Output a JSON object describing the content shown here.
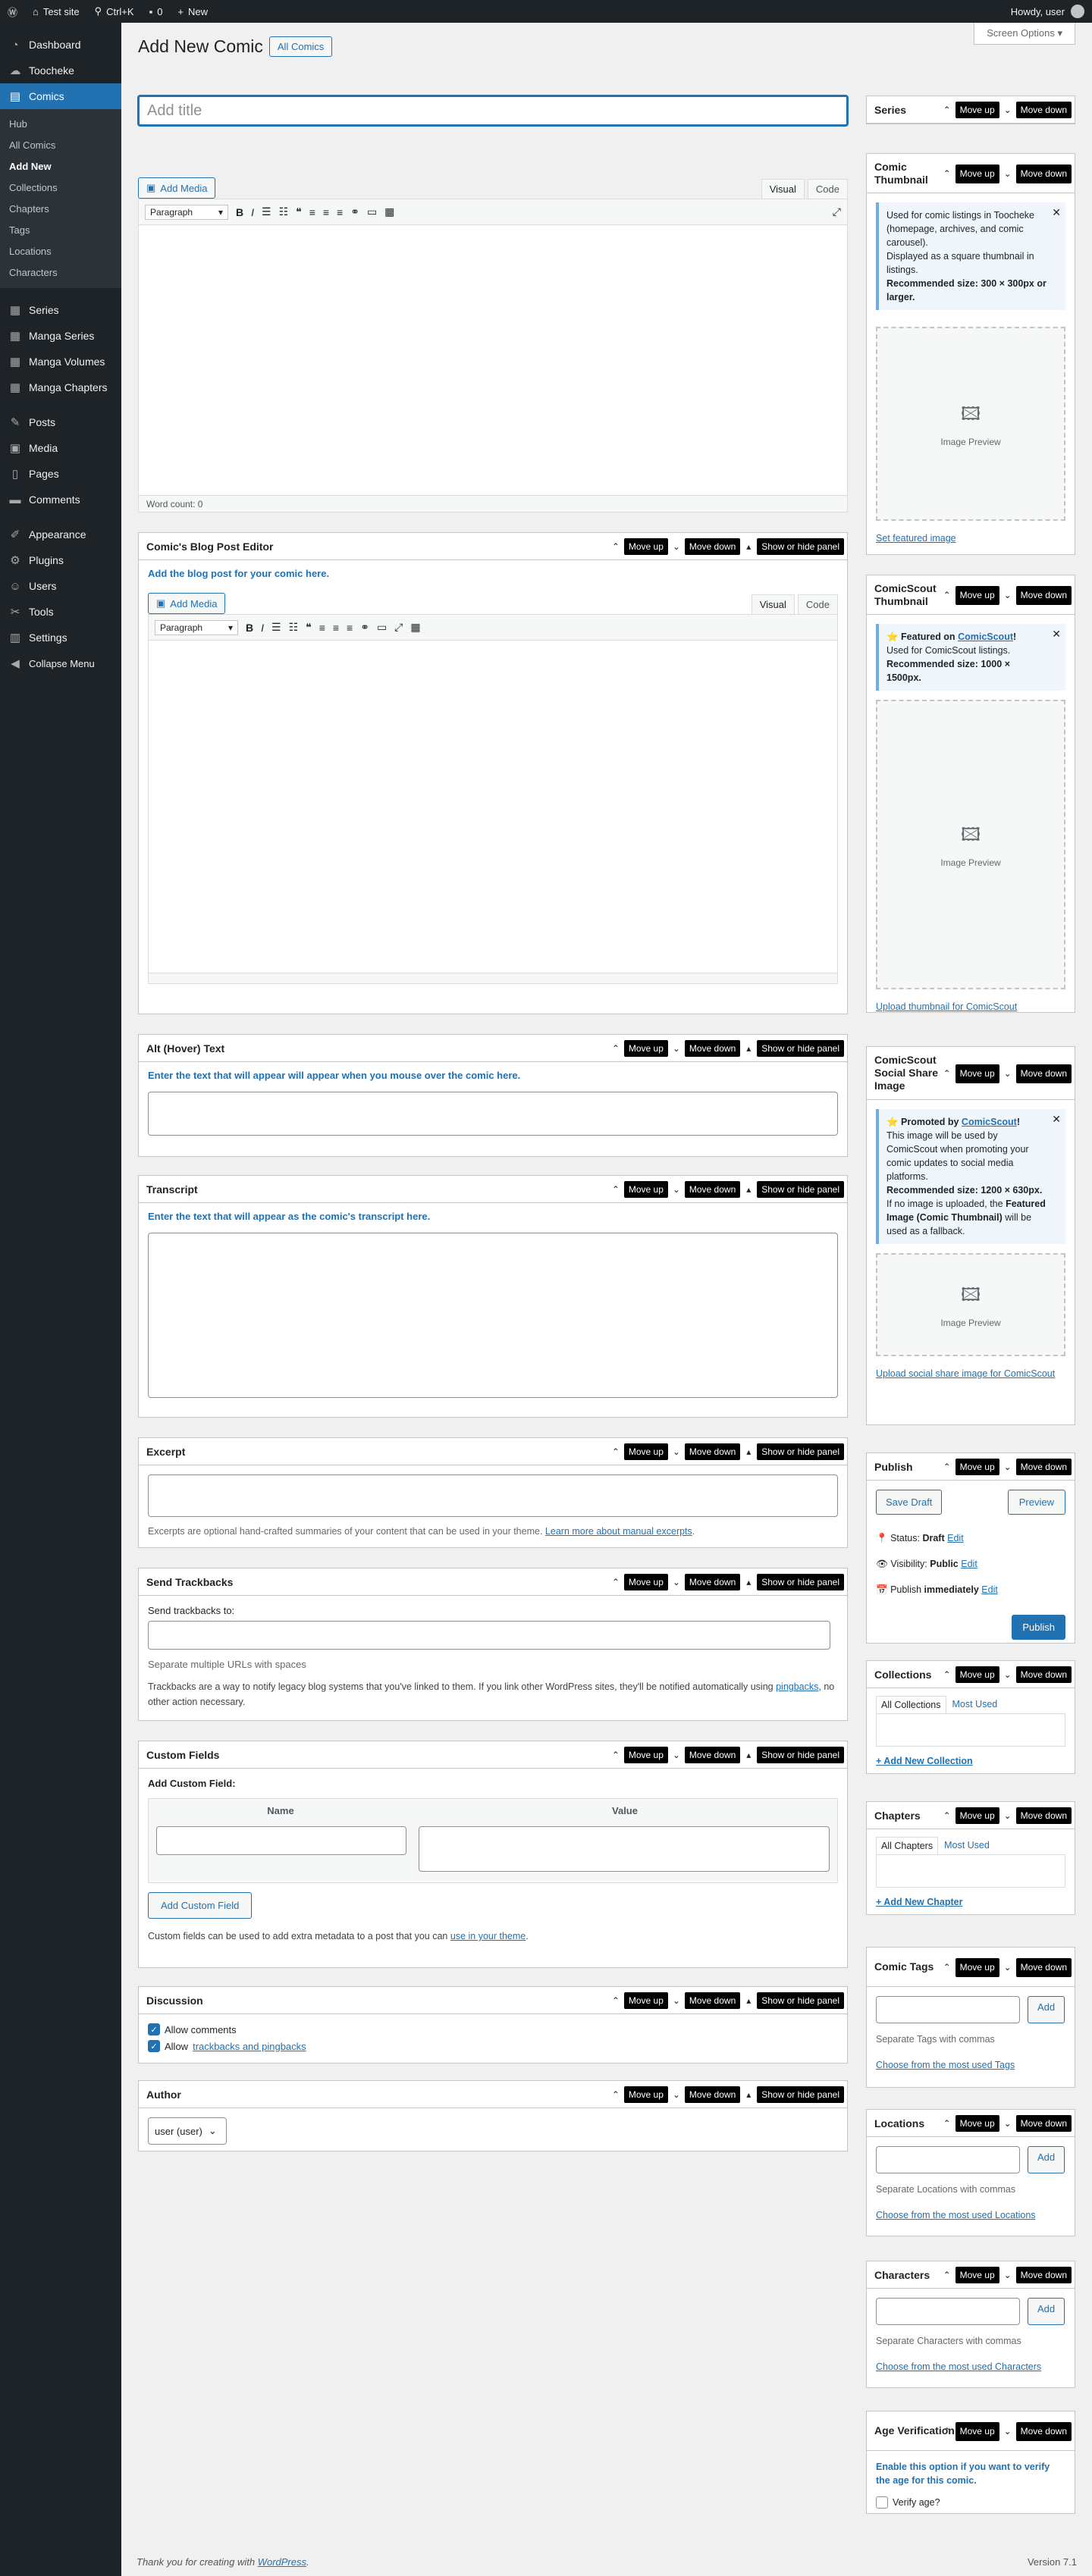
{
  "adminbar": {
    "site": "Test site",
    "search": "Ctrl+K",
    "comments": "0",
    "new": "New",
    "howdy": "Howdy, user"
  },
  "sidebar": {
    "items": [
      {
        "label": "Dashboard",
        "icon": "dashboard-icon"
      },
      {
        "label": "Toocheke",
        "icon": "toocheke-icon"
      },
      {
        "label": "Comics",
        "icon": "comics-icon"
      }
    ],
    "submenu": [
      "Hub",
      "All Comics",
      "Add New",
      "Collections",
      "Chapters",
      "Tags",
      "Locations",
      "Characters"
    ],
    "items2": [
      {
        "label": "Series",
        "icon": "series-icon"
      },
      {
        "label": "Manga Series",
        "icon": "manga-series-icon"
      },
      {
        "label": "Manga Volumes",
        "icon": "manga-volumes-icon"
      },
      {
        "label": "Manga Chapters",
        "icon": "manga-chapters-icon"
      }
    ],
    "items3": [
      {
        "label": "Posts",
        "icon": "pin-icon"
      },
      {
        "label": "Media",
        "icon": "media-icon"
      },
      {
        "label": "Pages",
        "icon": "pages-icon"
      },
      {
        "label": "Comments",
        "icon": "comments-icon"
      }
    ],
    "items4": [
      {
        "label": "Appearance",
        "icon": "appearance-icon"
      },
      {
        "label": "Plugins",
        "icon": "plugins-icon"
      },
      {
        "label": "Users",
        "icon": "users-icon"
      },
      {
        "label": "Tools",
        "icon": "tools-icon"
      },
      {
        "label": "Settings",
        "icon": "settings-icon"
      },
      {
        "label": "Collapse Menu",
        "icon": "collapse-icon"
      }
    ]
  },
  "page": {
    "title": "Add New Comic",
    "all_comics": "All Comics",
    "screen_options": "Screen Options",
    "title_placeholder": "Add title"
  },
  "editor": {
    "add_media": "Add Media",
    "visual": "Visual",
    "code": "Code",
    "paragraph": "Paragraph",
    "word_count": "Word count: 0"
  },
  "controls": {
    "move_up": "Move up",
    "move_down": "Move down",
    "toggle": "Show or hide panel"
  },
  "blog": {
    "title": "Comic's Blog Post Editor",
    "intro": "Add the blog post for your comic here."
  },
  "alt": {
    "title": "Alt (Hover) Text",
    "intro": "Enter the text that will appear will appear when you mouse over the comic here."
  },
  "transcript": {
    "title": "Transcript",
    "intro": "Enter the text that will appear as the comic's transcript here."
  },
  "excerpt": {
    "title": "Excerpt",
    "help": "Excerpts are optional hand-crafted summaries of your content that can be used in your theme.",
    "link": "Learn more about manual excerpts"
  },
  "trackbacks": {
    "title": "Send Trackbacks",
    "label": "Send trackbacks to:",
    "sep": "Separate multiple URLs with spaces",
    "help1": "Trackbacks are a way to notify legacy blog systems that you've linked to them. If you link other WordPress sites, they'll be notified automatically using",
    "link": "pingbacks",
    "help2": ", no other action necessary."
  },
  "custom": {
    "title": "Custom Fields",
    "add_label": "Add Custom Field:",
    "name": "Name",
    "value": "Value",
    "btn": "Add Custom Field",
    "help": "Custom fields can be used to add extra metadata to a post that you can",
    "link": "use in your theme"
  },
  "discussion": {
    "title": "Discussion",
    "allow_comments": "Allow comments",
    "allow": "Allow",
    "tp_link": "trackbacks and pingbacks"
  },
  "author": {
    "title": "Author",
    "value": "user (user)"
  },
  "series": {
    "title": "Series"
  },
  "thumb": {
    "title": "Comic Thumbnail",
    "n1": "Used for comic listings in Toocheke (homepage, archives, and comic carousel).",
    "n2": "Displayed as a square thumbnail in listings.",
    "rec": "Recommended size: 300 × 300px or larger.",
    "preview": "Image Preview",
    "link": "Set featured image"
  },
  "cs_thumb": {
    "title": "ComicScout Thumbnail",
    "featured": "⭐ Featured on",
    "cs": "ComicScout",
    "n1": "Used for ComicScout listings.",
    "rec": "Recommended size: 1000 × 1500px.",
    "preview": "Image Preview",
    "link": "Upload thumbnail for ComicScout"
  },
  "cs_share": {
    "title": "ComicScout Social Share Image",
    "promoted": "⭐ Promoted by",
    "cs": "ComicScout",
    "n1": "This image will be used by ComicScout when promoting your comic updates to social media platforms.",
    "rec": "Recommended size: 1200 × 630px.",
    "n2a": "If no image is uploaded, the",
    "n2b": "Featured Image (Comic Thumbnail)",
    "n2c": "will be used as a fallback.",
    "preview": "Image Preview",
    "link": "Upload social share image for ComicScout"
  },
  "publish": {
    "title": "Publish",
    "save": "Save Draft",
    "preview": "Preview",
    "status_l": "Status:",
    "status_v": "Draft",
    "vis_l": "Visibility:",
    "vis_v": "Public",
    "pub_l": "Publish",
    "pub_v": "immediately",
    "edit": "Edit",
    "btn": "Publish"
  },
  "collections": {
    "title": "Collections",
    "tab_all": "All Collections",
    "tab_most": "Most Used",
    "add": "+ Add New Collection"
  },
  "chapters": {
    "title": "Chapters",
    "tab_all": "All Chapters",
    "tab_most": "Most Used",
    "add": "+ Add New Chapter"
  },
  "tags": {
    "title": "Comic Tags",
    "add": "Add",
    "sep": "Separate Tags with commas",
    "choose": "Choose from the most used Tags"
  },
  "locations": {
    "title": "Locations",
    "add": "Add",
    "sep": "Separate Locations with commas",
    "choose": "Choose from the most used Locations"
  },
  "characters": {
    "title": "Characters",
    "add": "Add",
    "sep": "Separate Characters with commas",
    "choose": "Choose from the most used Characters"
  },
  "age": {
    "title": "Age Verification",
    "intro": "Enable this option if you want to verify the age for this comic.",
    "label": "Verify age?"
  },
  "footer": {
    "thanks": "Thank you for creating with",
    "wp": "WordPress",
    "version": "Version 7.1"
  }
}
